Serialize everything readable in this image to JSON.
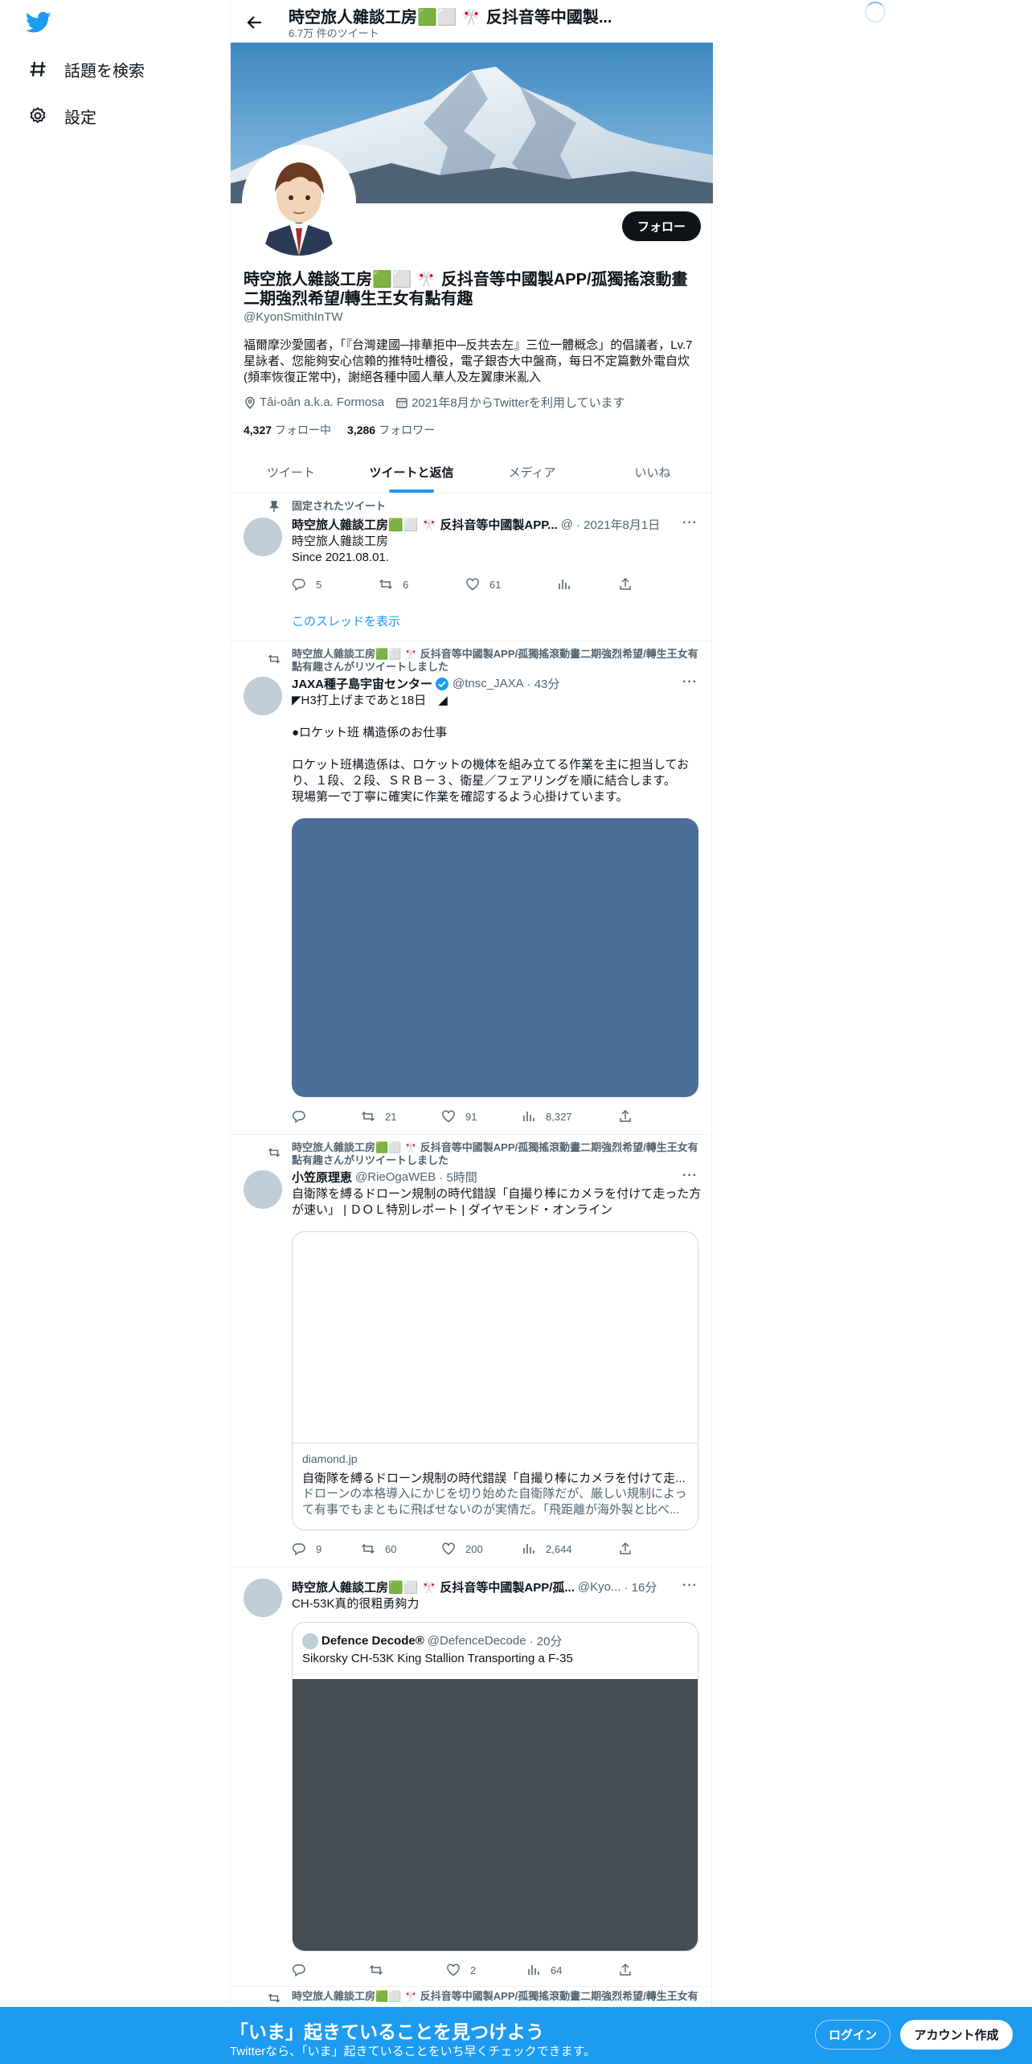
{
  "nav": {
    "explore_label": "話題を検索",
    "settings_label": "設定"
  },
  "header": {
    "title": "時空旅人雜談工房🟩⬜ 🎌 反抖音等中國製...",
    "tweet_count": "6.7万 件のツイート"
  },
  "profile": {
    "name": "時空旅人雜談工房🟩⬜ 🎌 反抖音等中國製APP/孤獨搖滾動畫二期強烈希望/轉生王女有點有趣",
    "handle": "@KyonSmithInTW",
    "bio": "福爾摩沙愛國者，「『台灣建國─排華拒中─反共去左』三位一體概念」的倡議者，Lv.7星詠者、您能夠安心信賴的推特吐槽役，電子銀杏大中盤商，每日不定篇數外電自炊(頻率恢復正常中)，謝絕各種中國人華人及左翼康米亂入",
    "location": "Tâi-oân a.k.a. Formosa",
    "joined": "2021年8月からTwitterを利用しています",
    "following_count": "4,327",
    "following_label": "フォロー中",
    "followers_count": "3,286",
    "followers_label": "フォロワー",
    "follow_button": "フォロー"
  },
  "tabs": [
    {
      "label": "ツイート"
    },
    {
      "label": "ツイートと返信"
    },
    {
      "label": "メディア"
    },
    {
      "label": "いいね"
    }
  ],
  "tweets": [
    {
      "context": "固定されたツイート",
      "name": "時空旅人雜談工房🟩⬜ 🎌 反抖音等中國製APP...",
      "handle": "@",
      "time": "· 2021年8月1日",
      "text": "時空旅人雜談工房\nSince 2021.08.01.",
      "replies": "5",
      "retweets": "6",
      "likes": "61",
      "thread_link": "このスレッドを表示"
    },
    {
      "context": "時空旅人雜談工房🟩⬜ 🎌 反抖音等中國製APP/孤獨搖滾動畫二期強烈希望/轉生王女有點有趣さんがリツイートしました",
      "name": "JAXA種子島宇宙センター",
      "handle": "@tnsc_JAXA",
      "time": "· 43分",
      "text": "◤H3打上げまであと18日　◢\n\n●ロケット班 構造係のお仕事\n\nロケット班構造係は、ロケットの機体を組み立てる作業を主に担当しており、１段、２段、ＳＲＢ－３、衛星／フェアリングを順に結合します。\n現場第一で丁寧に確実に作業を確認するよう心掛けています。",
      "replies": "",
      "retweets": "21",
      "likes": "91",
      "views": "8,327"
    },
    {
      "context": "時空旅人雜談工房🟩⬜ 🎌 反抖音等中國製APP/孤獨搖滾動畫二期強烈希望/轉生王女有點有趣さんがリツイートしました",
      "name": "小笠原理恵",
      "handle": "@RieOgaWEB",
      "time": "· 5時間",
      "text": "自衛隊を縛るドローン規制の時代錯誤「自撮り棒にカメラを付けて走った方が速い」 | ＤＯＬ特別レポート | ダイヤモンド・オンライン",
      "card_domain": "diamond.jp",
      "card_title": "自衛隊を縛るドローン規制の時代錯誤「自撮り棒にカメラを付けて走...",
      "card_desc": "ドローンの本格導入にかじを切り始めた自衛隊だが、厳しい規制によって有事でもまともに飛ばせないのが実情だ。「飛距離が海外製と比べ...",
      "replies": "9",
      "retweets": "60",
      "likes": "200",
      "views": "2,644"
    },
    {
      "name": "時空旅人雜談工房🟩⬜ 🎌 反抖音等中國製APP/孤...",
      "handle": "@Kyo...",
      "time": "· 16分",
      "text": "CH-53K真的很粗勇夠力",
      "quote_name": "Defence Decode®",
      "quote_handle": "@DefenceDecode",
      "quote_time": "· 20分",
      "quote_text": "Sikorsky CH-53K King Stallion Transporting a F-35",
      "replies": "",
      "retweets": "",
      "likes": "2",
      "views": "64"
    }
  ],
  "next_context": "時空旅人雜談工房🟩⬜ 🎌 反抖音等中國製APP/孤獨搖滾動畫二期強烈希望/轉生王女有",
  "bottom_bar": {
    "title": "「いま」起きていることを見つけよう",
    "subtitle": "Twitterなら、「いま」起きていることをいち早くチェックできます。",
    "login": "ログイン",
    "signup": "アカウント作成"
  },
  "colors": {
    "accent": "#1d9bf0",
    "text": "#0f1419",
    "muted": "#536471",
    "jaxa_media": "#4a6f98",
    "quote_media": "#454c52"
  }
}
